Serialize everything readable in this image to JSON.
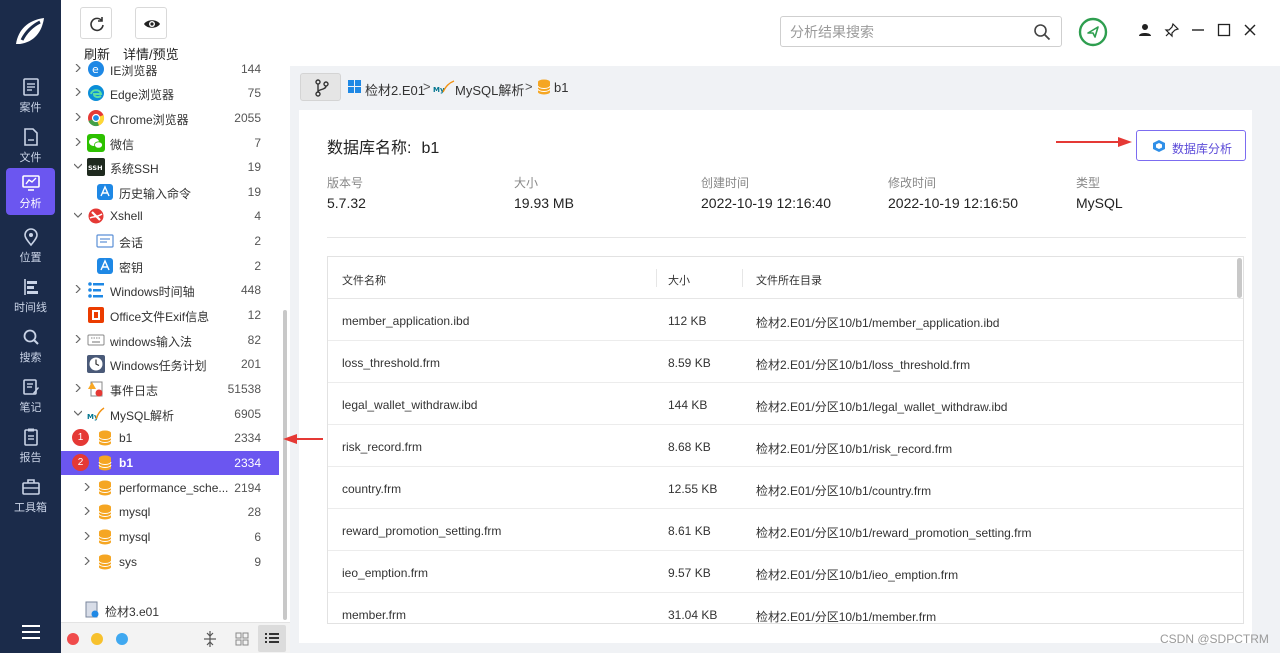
{
  "toolbar": {
    "refresh_label": "刷新",
    "preview_label": "详情/预览"
  },
  "rail": {
    "items": [
      {
        "label": "案件",
        "icon": "case-icon"
      },
      {
        "label": "文件",
        "icon": "file-icon"
      },
      {
        "label": "分析",
        "icon": "analysis-icon",
        "active": true
      },
      {
        "label": "位置",
        "icon": "location-icon"
      },
      {
        "label": "时间线",
        "icon": "timeline-icon"
      },
      {
        "label": "搜索",
        "icon": "search-icon"
      },
      {
        "label": "笔记",
        "icon": "note-icon"
      },
      {
        "label": "报告",
        "icon": "report-icon"
      },
      {
        "label": "工具箱",
        "icon": "toolbox-icon"
      }
    ]
  },
  "tree": {
    "items": [
      {
        "label": "IE浏览器",
        "count": "144"
      },
      {
        "label": "Edge浏览器",
        "count": "75"
      },
      {
        "label": "Chrome浏览器",
        "count": "2055"
      },
      {
        "label": "微信",
        "count": "7"
      },
      {
        "label": "系统SSH",
        "count": "19"
      },
      {
        "label": "历史输入命令",
        "count": "19"
      },
      {
        "label": "Xshell",
        "count": "4"
      },
      {
        "label": "会话",
        "count": "2"
      },
      {
        "label": "密钥",
        "count": "2"
      },
      {
        "label": "Windows时间轴",
        "count": "448"
      },
      {
        "label": "Office文件Exif信息",
        "count": "12"
      },
      {
        "label": "windows输入法",
        "count": "82"
      },
      {
        "label": "Windows任务计划",
        "count": "201"
      },
      {
        "label": "事件日志",
        "count": "51538"
      },
      {
        "label": "MySQL解析",
        "count": "6905"
      },
      {
        "label": "b1",
        "count": "2334",
        "badge": "1"
      },
      {
        "label": "b1",
        "count": "2334",
        "badge": "2",
        "selected": true
      },
      {
        "label": "performance_sche...",
        "count": "2194"
      },
      {
        "label": "mysql",
        "count": "28"
      },
      {
        "label": "mysql",
        "count": "6"
      },
      {
        "label": "sys",
        "count": "9"
      }
    ],
    "evidence": "检材3.e01"
  },
  "search": {
    "placeholder": "分析结果搜索",
    "value": ""
  },
  "breadcrumb": {
    "items": [
      "检材2.E01",
      "MySQL解析",
      "b1"
    ],
    "separator": ">"
  },
  "db": {
    "title_label": "数据库名称:",
    "title_value": "b1",
    "analyze_button": "数据库分析",
    "meta": [
      {
        "label": "版本号",
        "value": "5.7.32"
      },
      {
        "label": "大小",
        "value": "19.93 MB"
      },
      {
        "label": "创建时间",
        "value": "2022-10-19 12:16:40"
      },
      {
        "label": "修改时间",
        "value": "2022-10-19 12:16:50"
      },
      {
        "label": "类型",
        "value": "MySQL"
      }
    ]
  },
  "table": {
    "headers": [
      "文件名称",
      "大小",
      "文件所在目录"
    ],
    "rows": [
      [
        "member_application.ibd",
        "112 KB",
        "检材2.E01/分区10/b1/member_application.ibd"
      ],
      [
        "loss_threshold.frm",
        "8.59 KB",
        "检材2.E01/分区10/b1/loss_threshold.frm"
      ],
      [
        "legal_wallet_withdraw.ibd",
        "144 KB",
        "检材2.E01/分区10/b1/legal_wallet_withdraw.ibd"
      ],
      [
        "risk_record.frm",
        "8.68 KB",
        "检材2.E01/分区10/b1/risk_record.frm"
      ],
      [
        "country.frm",
        "12.55 KB",
        "检材2.E01/分区10/b1/country.frm"
      ],
      [
        "reward_promotion_setting.frm",
        "8.61 KB",
        "检材2.E01/分区10/b1/reward_promotion_setting.frm"
      ],
      [
        "ieo_emption.frm",
        "9.57 KB",
        "检材2.E01/分区10/b1/ieo_emption.frm"
      ],
      [
        "member.frm",
        "31.04 KB",
        "检材2.E01/分区10/b1/member.frm"
      ]
    ]
  },
  "watermark": "CSDN @SDPCTRM",
  "colors": {
    "rail_bg": "#1b2b4a",
    "accent": "#6b56f0",
    "annotation_red": "#e53935",
    "status_green": "#2e9e4f"
  }
}
